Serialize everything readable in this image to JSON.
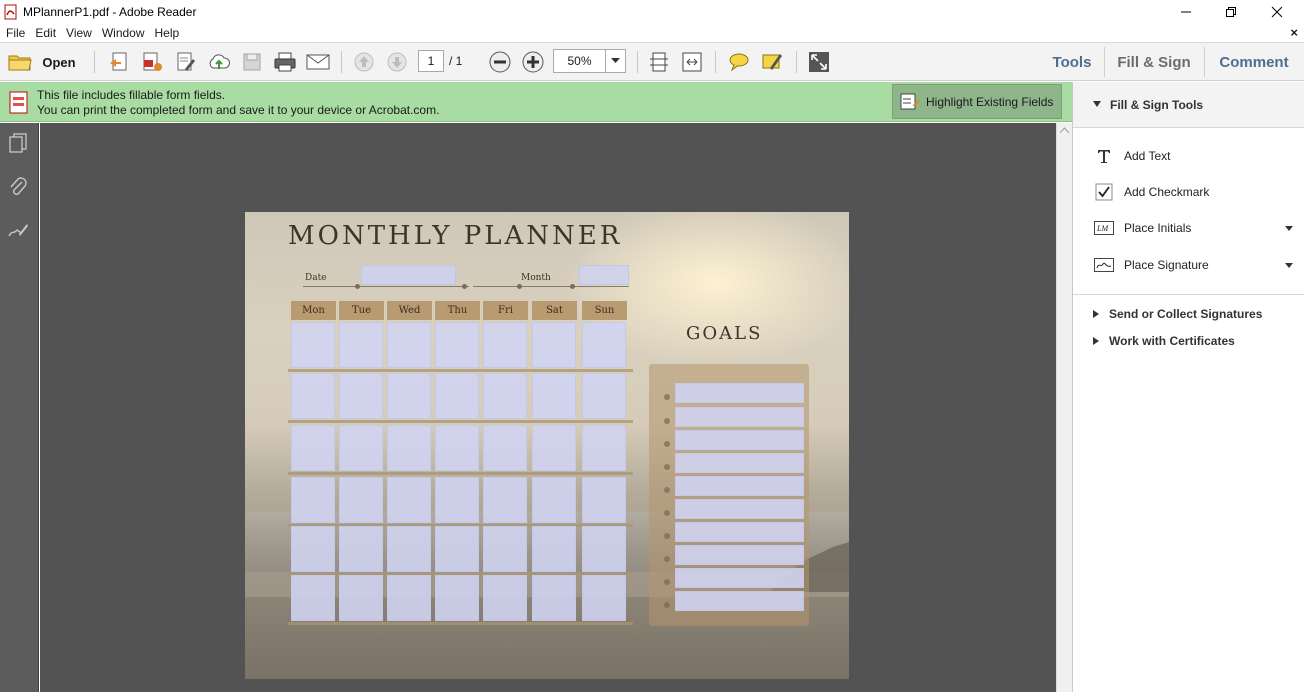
{
  "window": {
    "title": "MPlannerP1.pdf - Adobe Reader",
    "minimize": "–",
    "restore": "❐",
    "close": "✕"
  },
  "menu": {
    "items": [
      "File",
      "Edit",
      "View",
      "Window",
      "Help"
    ],
    "doc_close": "×"
  },
  "toolbar": {
    "open_label": "Open",
    "page_current": "1",
    "page_total": "/ 1",
    "zoom": "50%",
    "tabs": {
      "tools": "Tools",
      "fill_sign": "Fill & Sign",
      "comment": "Comment"
    }
  },
  "notification": {
    "line1": "This file includes fillable form fields.",
    "line2": "You can print the completed form and save it to your device or Acrobat.com.",
    "highlight_button": "Highlight Existing Fields"
  },
  "document": {
    "title": "MONTHLY PLANNER",
    "date_label": "Date",
    "month_label": "Month",
    "days": [
      "Mon",
      "Tue",
      "Wed",
      "Thu",
      "Fri",
      "Sat",
      "Sun"
    ],
    "goals_title": "GOALS"
  },
  "right_panel": {
    "section_title": "Fill & Sign Tools",
    "tools": [
      {
        "label": "Add Text",
        "icon": "text-icon"
      },
      {
        "label": "Add Checkmark",
        "icon": "checkmark-icon"
      },
      {
        "label": "Place Initials",
        "icon": "initials-icon"
      },
      {
        "label": "Place Signature",
        "icon": "signature-icon"
      }
    ],
    "sections": [
      {
        "label": "Send or Collect Signatures"
      },
      {
        "label": "Work with Certificates"
      }
    ]
  },
  "colors": {
    "toolbar_tab": "#4d6e93",
    "notify_bg": "#a9dca2",
    "doc_bg": "#535353",
    "form_field": "#d0d4f2"
  }
}
